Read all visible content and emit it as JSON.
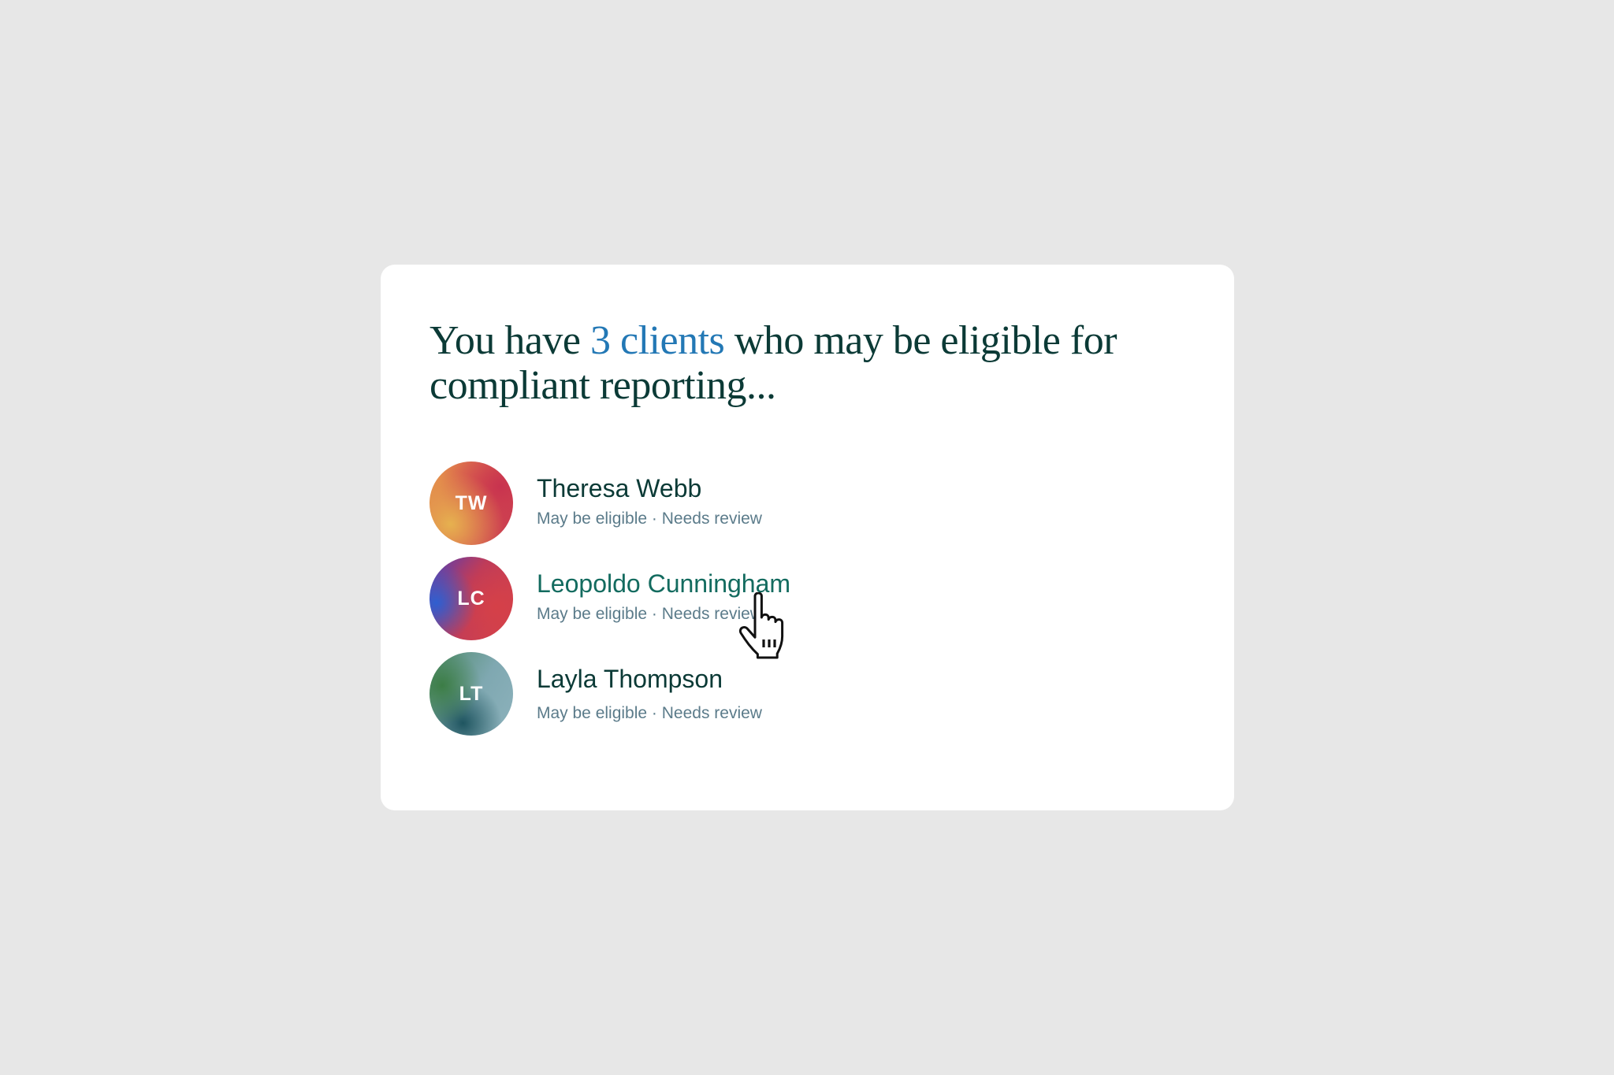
{
  "headline": {
    "before": "You have ",
    "highlight": "3 clients",
    "after": " who may be eligible for compliant reporting..."
  },
  "clients": [
    {
      "initials": "TW",
      "name": "Theresa Webb",
      "status": "May be eligible · Needs review"
    },
    {
      "initials": "LC",
      "name": "Leopoldo Cunningham",
      "status": "May be eligible · Needs review"
    },
    {
      "initials": "LT",
      "name": "Layla Thompson",
      "status": "May be eligible · Needs review"
    }
  ],
  "cursor": {
    "icon": "hand-pointer-icon"
  },
  "colors": {
    "background": "#e7e7e7",
    "card": "#ffffff",
    "text_primary": "#0b3a36",
    "highlight": "#2378b5",
    "hover_name": "#136b5f",
    "status_text": "#5b7b8a"
  }
}
